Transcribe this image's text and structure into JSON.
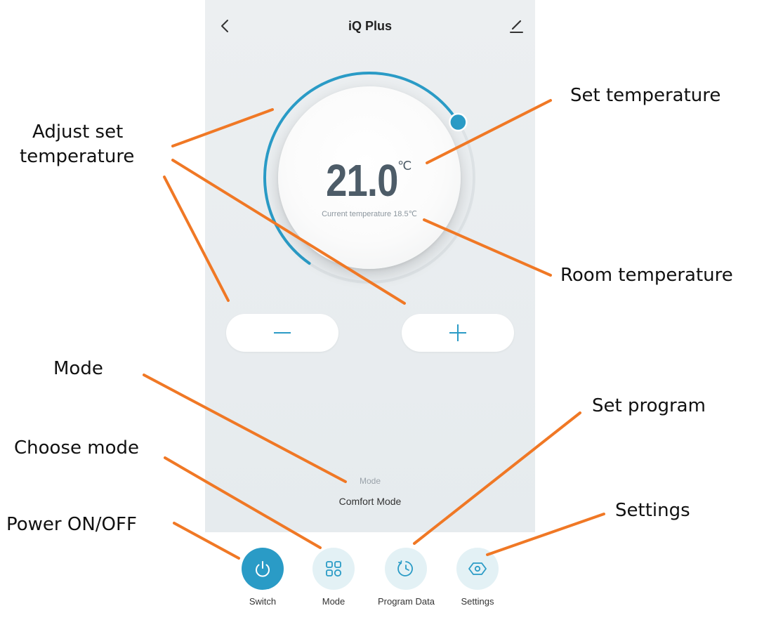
{
  "app": {
    "title": "iQ Plus"
  },
  "thermostat": {
    "set_temp": "21.0",
    "unit": "℃",
    "current_label": "Current temperature 18.5℃",
    "set_fraction": 0.7
  },
  "controls": {
    "minus_icon": "minus-icon",
    "plus_icon": "plus-icon"
  },
  "mode": {
    "label": "Mode",
    "value": "Comfort Mode"
  },
  "tabs": [
    {
      "label": "Switch",
      "icon": "power-icon",
      "active": true
    },
    {
      "label": "Mode",
      "icon": "grid-icon",
      "active": false
    },
    {
      "label": "Program Data",
      "icon": "clock-icon",
      "active": false
    },
    {
      "label": "Settings",
      "icon": "hexagon-icon",
      "active": false
    }
  ],
  "annotations": {
    "adjust": "Adjust set\ntemperature",
    "set_temperature": "Set temperature",
    "room_temperature": "Room temperature",
    "mode": "Mode",
    "set_program": "Set program",
    "choose_mode": "Choose mode",
    "power": "Power ON/OFF",
    "settings": "Settings"
  },
  "colors": {
    "accent": "#2a9bc6",
    "annotation_line": "#f07825",
    "screen_bg": "#e8ecef"
  }
}
